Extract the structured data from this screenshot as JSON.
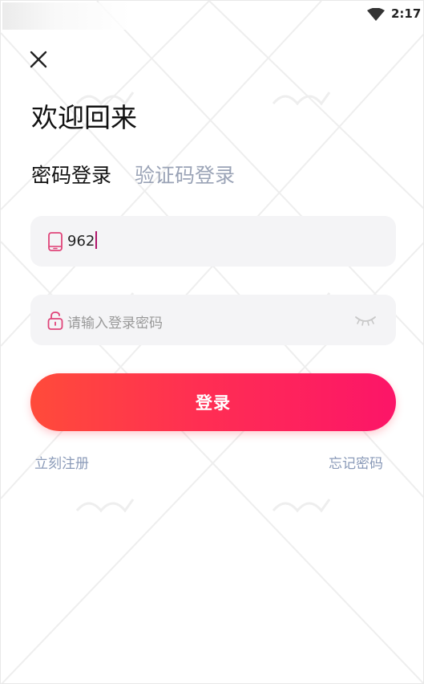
{
  "status_bar": {
    "time": "2:17",
    "wifi_icon": "wifi-icon"
  },
  "header": {
    "close_icon": "close-icon"
  },
  "page": {
    "title": "欢迎回来"
  },
  "tabs": [
    {
      "label": "密码登录",
      "active": true
    },
    {
      "label": "验证码登录",
      "active": false
    }
  ],
  "phone_field": {
    "icon": "phone-icon",
    "value": "962"
  },
  "password_field": {
    "icon": "lock-icon",
    "placeholder": "请输入登录密码",
    "toggle_icon": "eye-closed-icon"
  },
  "login_button": {
    "label": "登录"
  },
  "links": {
    "register": "立刻注册",
    "forgot_password": "忘记密码"
  },
  "colors": {
    "accent_start": "#ff4b3a",
    "accent_end": "#fc1568",
    "tab_inactive": "#9aa3b6",
    "link": "#8a9ab8",
    "icon_pink": "#e0457a"
  }
}
